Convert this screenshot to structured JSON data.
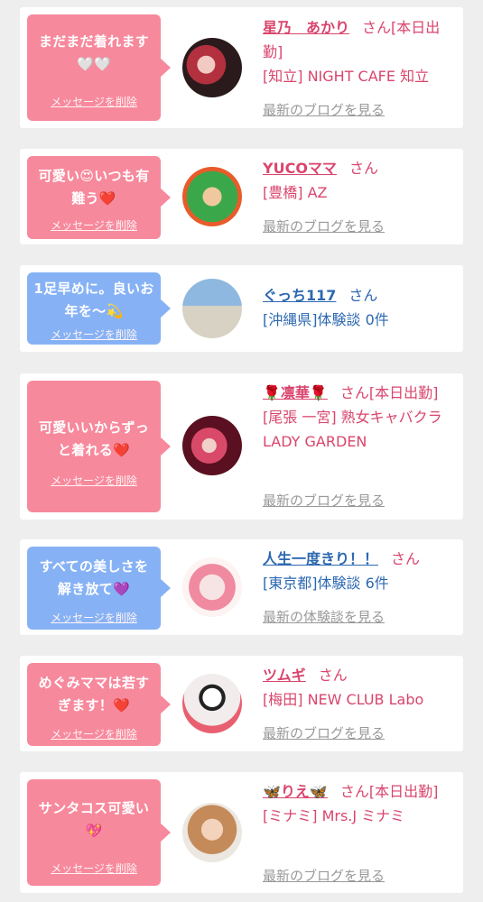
{
  "entries": [
    {
      "message": "まだまだ着れます🤍🤍",
      "delete_label": "メッセージを削除",
      "name": "星乃　あかり",
      "suffix": "さん[本日出勤]",
      "shop": "[知立] NIGHT CAFE 知立",
      "link": "最新のブログを見る",
      "theme": "pink"
    },
    {
      "message": "可愛い😍いつも有難う❤️",
      "delete_label": "メッセージを削除",
      "name": "YUCOママ",
      "suffix": "さん",
      "shop": "[豊橋] AZ",
      "link": "最新のブログを見る",
      "theme": "pink"
    },
    {
      "message": "1足早めに。良いお年を〜💫",
      "delete_label": "メッセージを削除",
      "name": "ぐっち117",
      "suffix": "さん",
      "shop": "[沖縄県]体験談 0件",
      "link": "",
      "theme": "blue"
    },
    {
      "message": "可愛いいからずっと着れる❤️",
      "delete_label": "メッセージを削除",
      "name": "🌹凛華🌹",
      "suffix": "さん[本日出勤]",
      "shop": "[尾張 一宮] 熟女キャバクラ LADY GARDEN",
      "link": "最新のブログを見る",
      "theme": "pink"
    },
    {
      "message": "すべての美しさを解き放て💜",
      "delete_label": "メッセージを削除",
      "name": "人生一度きり！！",
      "suffix": "さん",
      "shop": "[東京都]体験談 6件",
      "link": "最新の体験談を見る",
      "theme": "blue"
    },
    {
      "message": "めぐみママは若すぎます！❤️",
      "delete_label": "メッセージを削除",
      "name": "ツムギ",
      "suffix": "さん",
      "shop": "[梅田] NEW CLUB Labo",
      "link": "最新のブログを見る",
      "theme": "pink"
    },
    {
      "message": "サンタコス可愛い💖",
      "delete_label": "メッセージを削除",
      "name": "🦋りえ🦋",
      "suffix": "さん[本日出勤]",
      "shop": "[ミナミ] Mrs.J ミナミ",
      "link": "最新のブログを見る",
      "theme": "pink"
    }
  ],
  "colors": {
    "page_background": "#eeeeee",
    "bubble_pink": "#f7899c",
    "bubble_blue": "#86b2f5",
    "name_pink": "#d9456d",
    "name_blue": "#2c68b0",
    "link_gray": "#999999"
  }
}
